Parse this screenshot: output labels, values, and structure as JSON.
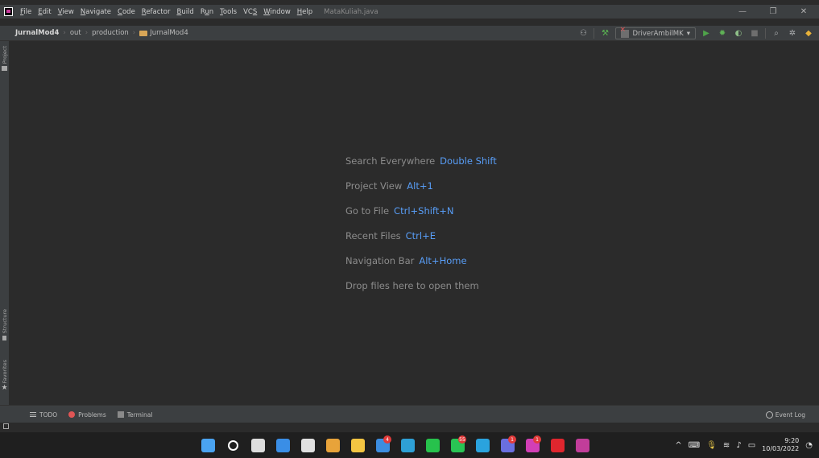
{
  "window": {
    "menus": [
      {
        "underline": "F",
        "rest": "ile"
      },
      {
        "underline": "E",
        "rest": "dit"
      },
      {
        "underline": "V",
        "rest": "iew"
      },
      {
        "underline": "N",
        "rest": "avigate"
      },
      {
        "underline": "C",
        "rest": "ode"
      },
      {
        "underline": "R",
        "rest": "efactor"
      },
      {
        "underline": "B",
        "rest": "uild"
      },
      {
        "pre": "R",
        "underline": "u",
        "rest": "n"
      },
      {
        "underline": "T",
        "rest": "ools"
      },
      {
        "pre": "VC",
        "underline": "S",
        "rest": ""
      },
      {
        "underline": "W",
        "rest": "indow"
      },
      {
        "underline": "H",
        "rest": "elp"
      }
    ],
    "file_title": "MataKuliah.java",
    "controls": {
      "minimize": "—",
      "restore": "❐",
      "close": "✕"
    }
  },
  "navbar": {
    "crumbs": [
      "JurnalMod4",
      "out",
      "production",
      "JurnalMod4"
    ],
    "run_config": "DriverAmbilMK"
  },
  "side_tabs": {
    "project": "Project",
    "structure": "Structure",
    "favorites": "Favorites"
  },
  "editor_hints": [
    {
      "label": "Search Everywhere",
      "key": "Double Shift"
    },
    {
      "label": "Project View",
      "key": "Alt+1"
    },
    {
      "label": "Go to File",
      "key": "Ctrl+Shift+N"
    },
    {
      "label": "Recent Files",
      "key": "Ctrl+E"
    },
    {
      "label": "Navigation Bar",
      "key": "Alt+Home"
    }
  ],
  "drop_text": "Drop files here to open them",
  "bottom_tabs": {
    "todo": "TODO",
    "problems": "Problems",
    "terminal": "Terminal",
    "event_log": "Event Log"
  },
  "taskbar": {
    "apps": [
      {
        "name": "start",
        "color": "#4aa3f0"
      },
      {
        "name": "search",
        "color": "#ffffff"
      },
      {
        "name": "task-view",
        "color": "#dddddd"
      },
      {
        "name": "widgets",
        "color": "#3a8ee6"
      },
      {
        "name": "terminal",
        "color": "#e0e0e0"
      },
      {
        "name": "chrome",
        "color": "#e8a33a"
      },
      {
        "name": "file-explorer",
        "color": "#f4c542"
      },
      {
        "name": "mail",
        "color": "#3c8de0",
        "badge": "4"
      },
      {
        "name": "edge",
        "color": "#2ea0d6"
      },
      {
        "name": "line",
        "color": "#27c24c"
      },
      {
        "name": "whatsapp",
        "color": "#29c454",
        "badge": "55"
      },
      {
        "name": "telegram",
        "color": "#2aa3de"
      },
      {
        "name": "teams",
        "color": "#6a6fe0",
        "badge": "1"
      },
      {
        "name": "messenger",
        "color": "#d23fb6",
        "badge": "1"
      },
      {
        "name": "opera",
        "color": "#e0262e"
      },
      {
        "name": "intellij",
        "color": "#c23d9a"
      }
    ],
    "clock_time": "9:20",
    "clock_date": "10/03/2022"
  }
}
